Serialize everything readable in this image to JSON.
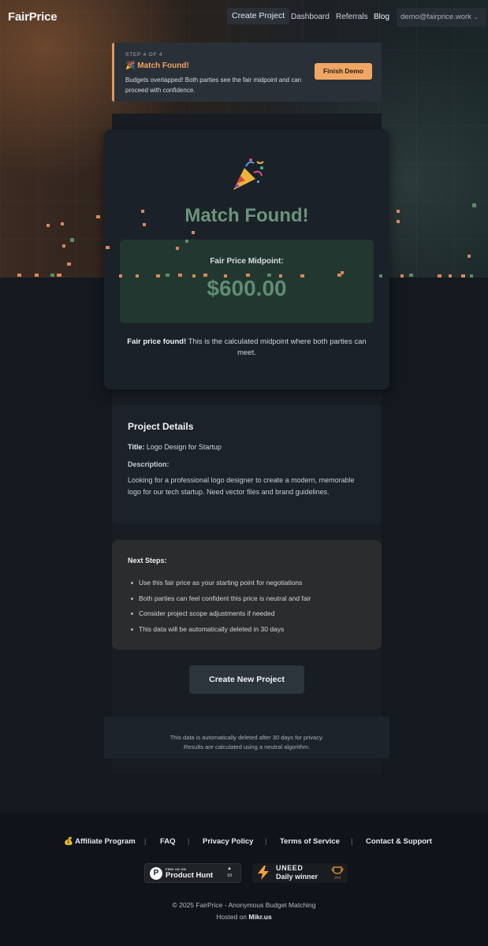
{
  "nav": {
    "brand": "FairPrice",
    "create_project": "Create Project",
    "dashboard": "Dashboard",
    "referrals": "Referrals",
    "blog": "Blog",
    "user_email": "demo@fairprice.work"
  },
  "banner": {
    "step": "STEP 4 OF 4",
    "title": "🎉 Match Found!",
    "description": "Budgets overlapped! Both parties see the fair midpoint and can proceed with confidence.",
    "button": "Finish Demo"
  },
  "match": {
    "title": "Match Found!",
    "midpoint_label": "Fair Price Midpoint:",
    "midpoint_value": "$600.00",
    "found_bold": "Fair price found!",
    "found_text": " This is the calculated midpoint where both parties can meet."
  },
  "project": {
    "heading": "Project Details",
    "title_label": "Title:",
    "title_value": " Logo Design for Startup",
    "description_label": "Description:",
    "description_value": "Looking for a professional logo designer to create a modern, memorable logo for our tech startup. Need vector files and brand guidelines."
  },
  "next_steps": {
    "heading": "Next Steps:",
    "items": [
      "Use this fair price as your starting point for negotiations",
      "Both parties can feel confident this price is neutral and fair",
      "Consider project scope adjustments if needed",
      "This data will be automatically deleted in 30 days"
    ]
  },
  "cta": "Create New Project",
  "privacy": {
    "line1": "This data is automatically deleted after 30 days for privacy.",
    "line2": "Results are calculated using a neutral algorithm."
  },
  "footer": {
    "links": [
      "💰 Affiliate Program",
      "FAQ",
      "Privacy Policy",
      "Terms of Service",
      "Contact & Support"
    ],
    "separator": "|",
    "producthunt_small": "FIND US ON",
    "producthunt_name": "Product Hunt",
    "producthunt_arrow": "▲",
    "producthunt_count": "10",
    "uneed_logo": "UNEED",
    "uneed_sub": "Daily winner",
    "uneed_rank": "2nd",
    "copyright": "© 2025 FairPrice - Anonymous Budget Matching",
    "hosted_prefix": "Hosted on ",
    "hosted_host": "Mikr.us"
  },
  "colors": {
    "accent_orange": "#f0a765",
    "success_green": "#6b9478",
    "background": "#141920"
  }
}
